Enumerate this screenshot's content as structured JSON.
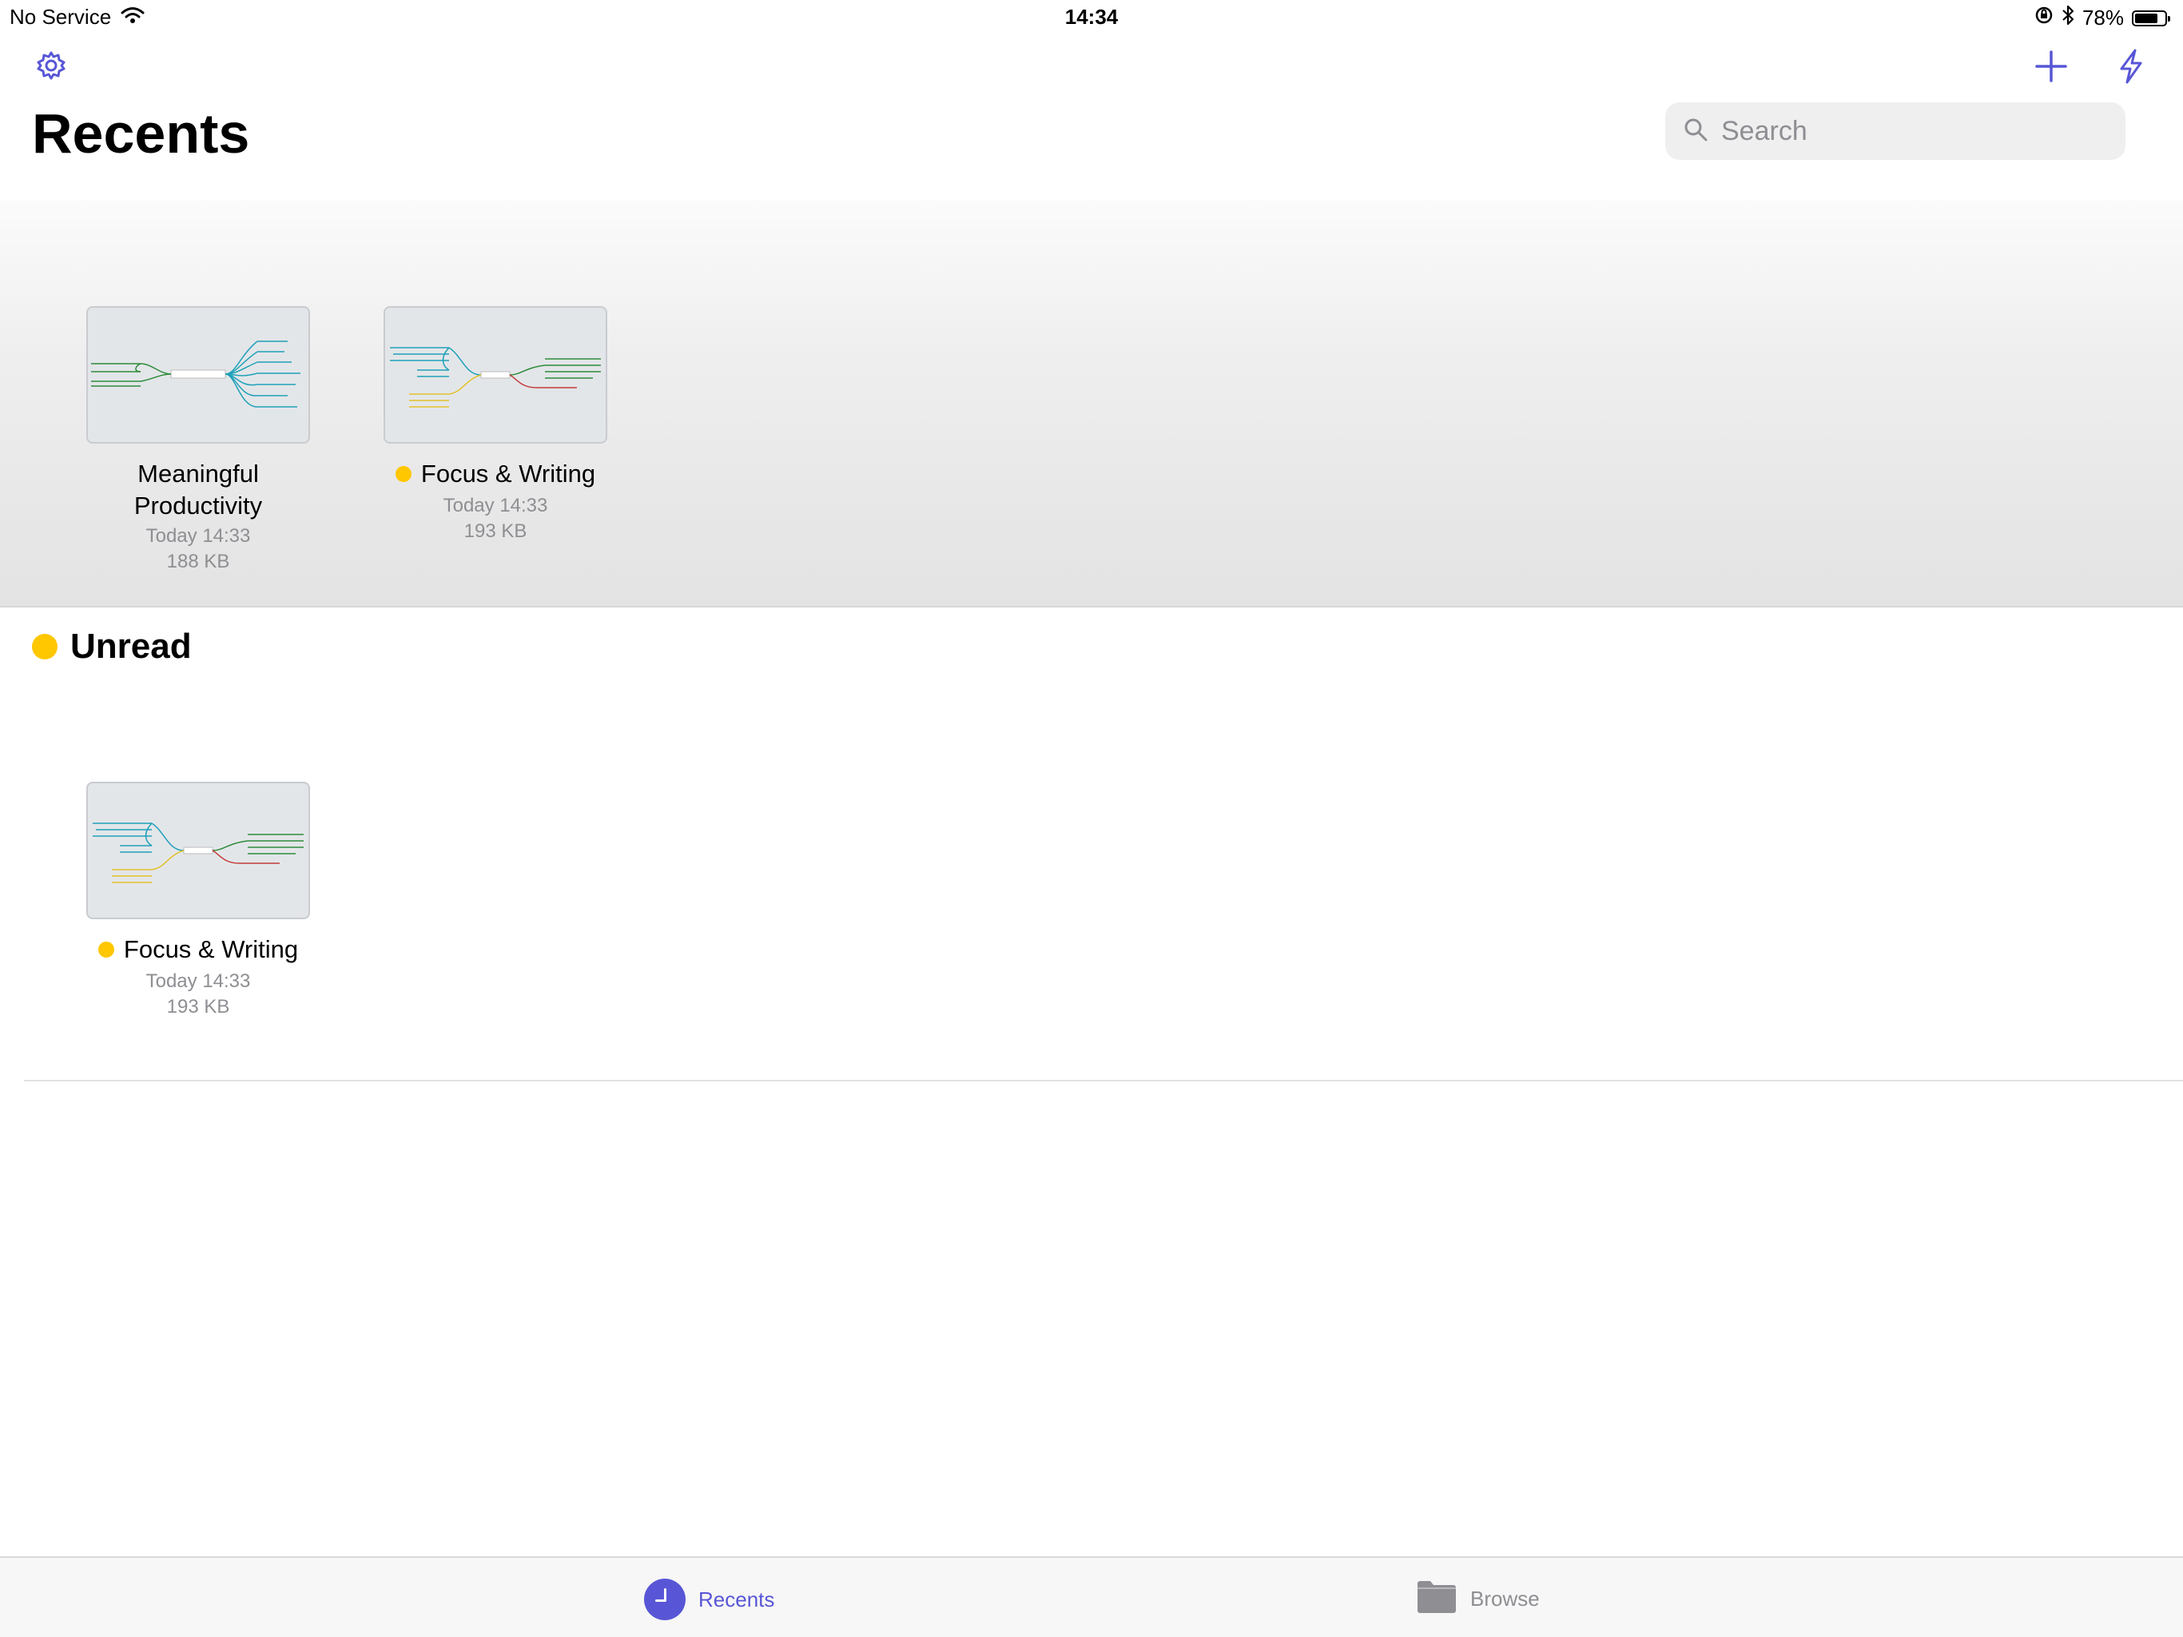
{
  "status_bar": {
    "carrier": "No Service",
    "time": "14:34",
    "battery_percent": "78%",
    "battery_level": 0.78
  },
  "toolbar": {
    "settings_icon": "gear-icon",
    "add_icon": "plus-icon",
    "quick_icon": "lightning-icon"
  },
  "page": {
    "title": "Recents"
  },
  "search": {
    "placeholder": "Search",
    "value": ""
  },
  "recents": [
    {
      "name": "Meaningful Productivity",
      "unread": false,
      "date": "Today 14:33",
      "size": "188 KB"
    },
    {
      "name": "Focus & Writing",
      "unread": true,
      "date": "Today 14:33",
      "size": "193 KB"
    }
  ],
  "unread_section": {
    "title": "Unread",
    "items": [
      {
        "name": "Focus & Writing",
        "unread": true,
        "date": "Today 14:33",
        "size": "193 KB"
      }
    ]
  },
  "tabbar": {
    "recents_label": "Recents",
    "browse_label": "Browse",
    "active": "Recents"
  },
  "colors": {
    "accent": "#5856d6",
    "unread_dot": "#ffc700",
    "secondary_text": "#8e8e93"
  }
}
